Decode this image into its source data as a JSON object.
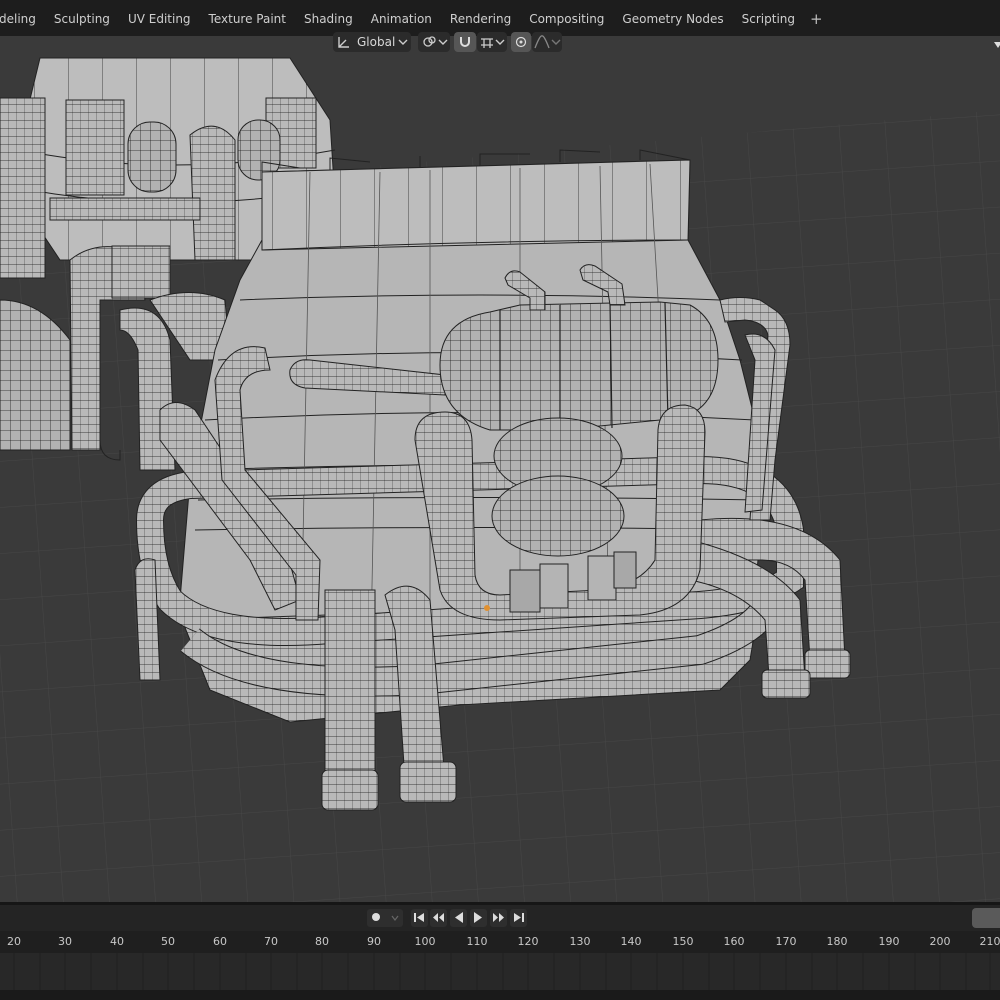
{
  "workspace_tabs": [
    "deling",
    "Sculpting",
    "UV Editing",
    "Texture Paint",
    "Shading",
    "Animation",
    "Rendering",
    "Compositing",
    "Geometry Nodes",
    "Scripting",
    "+"
  ],
  "header": {
    "orientation_label": "Global",
    "transform_icon": "transform-orientation-icon",
    "pivot_icon": "pivot-point-icon",
    "snap_icon": "snap-magnet-icon",
    "snap_target_icon": "snap-increment-icon",
    "proportional_icon": "proportional-editing-icon",
    "falloff_icon": "falloff-curve-icon"
  },
  "timeline": {
    "keyframe_icon": "record-keyframe-icon",
    "playback_icons": [
      "jump-start-icon",
      "prev-keyframe-icon",
      "play-reverse-icon",
      "play-icon",
      "next-keyframe-icon",
      "jump-end-icon"
    ],
    "frame_ticks": [
      "20",
      "30",
      "40",
      "50",
      "60",
      "70",
      "80",
      "90",
      "100",
      "110",
      "120",
      "130",
      "140",
      "150",
      "160",
      "170",
      "180",
      "190",
      "200",
      "210"
    ]
  },
  "colors": {
    "viewport_bg": "#3a3a3a",
    "mesh_face": "#b4b4b4",
    "mesh_wire": "#111111",
    "topbar_bg": "#1d1d1d"
  }
}
